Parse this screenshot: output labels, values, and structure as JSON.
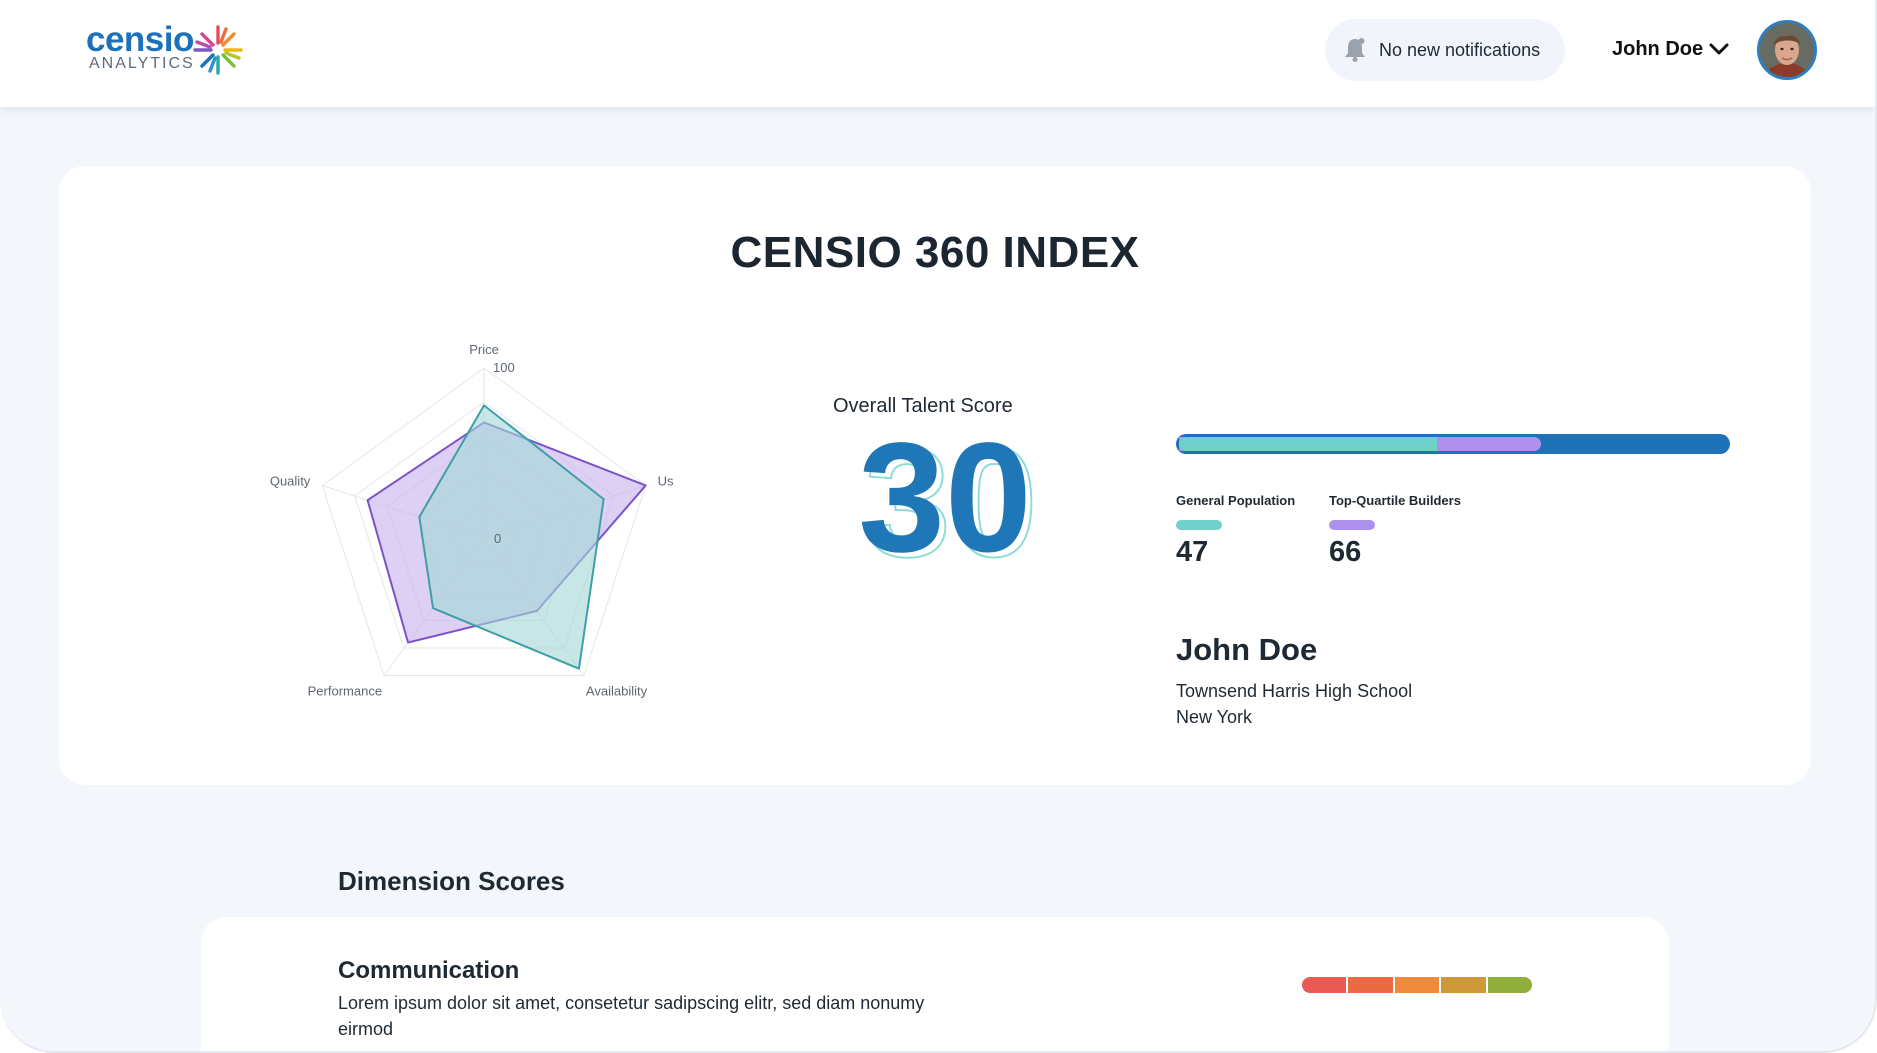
{
  "header": {
    "logo": {
      "word": "censio",
      "sub": "ANALYTICS"
    },
    "notifications": {
      "text": "No new notifications",
      "icon": "bell-icon"
    },
    "user": {
      "name": "John Doe",
      "icon": "chevron-down-icon"
    }
  },
  "index": {
    "title": "CENSIO 360 INDEX",
    "score_label": "Overall Talent Score",
    "score": "30",
    "comparison": {
      "track_color": "#1f72b8",
      "general_population": {
        "label": "General Population",
        "value": "47",
        "fraction": 0.47,
        "color": "#6fd1c9"
      },
      "top_quartile": {
        "label": "Top-Quartile Builders",
        "value": "66",
        "fraction": 0.66,
        "color": "#ad90ec"
      }
    },
    "person": {
      "name": "John Doe",
      "school": "Townsend Harris High School",
      "city": "New York"
    }
  },
  "chart_data": {
    "type": "radar",
    "axes": [
      "Price",
      "Usability",
      "Availability",
      "Performance",
      "Quality"
    ],
    "range": [
      0,
      100
    ],
    "tick_labels": [
      "0",
      "100"
    ],
    "rings": 5,
    "series": [
      {
        "values": [
          68,
          100,
          53,
          76,
          72
        ],
        "color": "#7b52c9",
        "fill": "#c8b3ee"
      },
      {
        "values": [
          78,
          74,
          95,
          51,
          40
        ],
        "color": "#3f9fa6",
        "fill": "#a5d8d6"
      }
    ]
  },
  "dimensions": {
    "title": "Dimension Scores",
    "items": [
      {
        "name": "Communication",
        "description": "Lorem ipsum dolor sit amet, consetetur sadipscing elitr, sed diam nonumy eirmod",
        "scale_colors": [
          "#ea5a55",
          "#eb6a44",
          "#ec8a3d",
          "#cf983a",
          "#8fae3c"
        ]
      }
    ]
  }
}
